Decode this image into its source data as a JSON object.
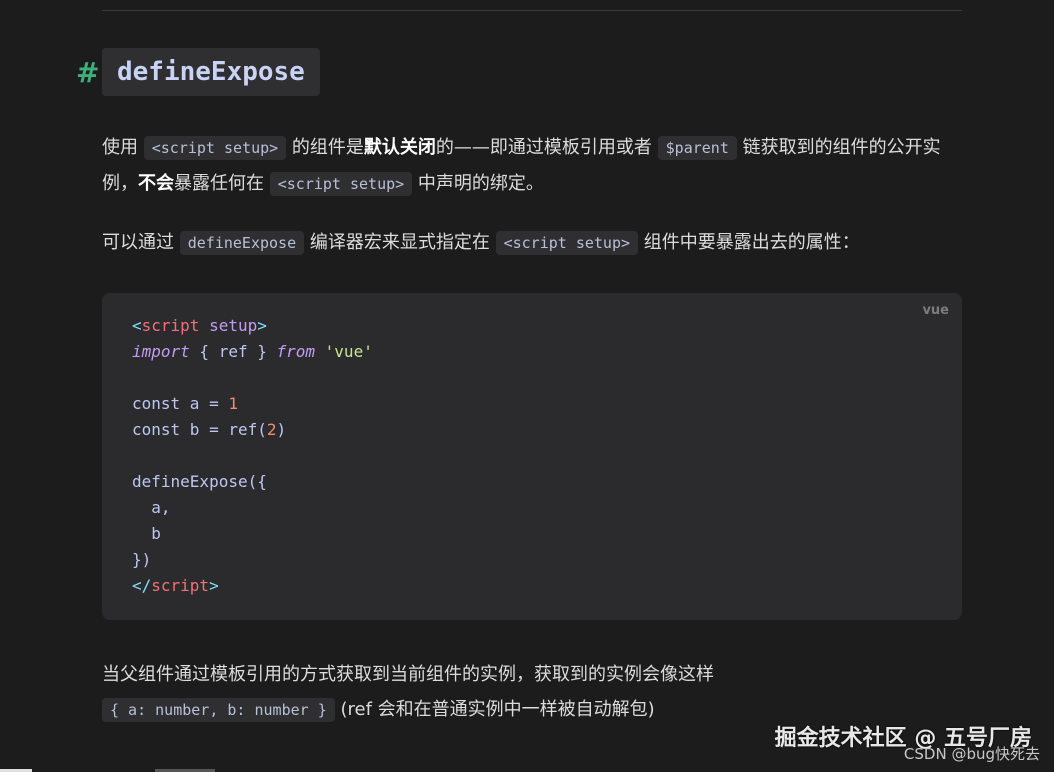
{
  "heading": {
    "hash": "#",
    "title": "defineExpose"
  },
  "p1": {
    "t1": "使用",
    "c1": "<script setup>",
    "t2": "的组件是",
    "b1": "默认关闭",
    "t3": "的——即通过模板引用或者",
    "c2": "$parent",
    "t4": "链获取到的组件的公开实例，",
    "b2": "不会",
    "t5": "暴露任何在",
    "c3": "<script setup>",
    "t6": "中声明的绑定。"
  },
  "p2": {
    "t1": "可以通过",
    "c1": "defineExpose",
    "t2": "编译器宏来显式指定在",
    "c2": "<script setup>",
    "t3": "组件中要暴露出去的属性："
  },
  "code": {
    "lang": "vue",
    "l1_open": "<",
    "l1_tag": "script",
    "l1_attr": " setup",
    "l1_close": ">",
    "l2_import": "import",
    "l2_mid": " { ref } ",
    "l2_from": "from",
    "l2_str": " 'vue'",
    "l4_text": "const a = ",
    "l4_num": "1",
    "l5_text": "const b = ref(",
    "l5_num": "2",
    "l5_end": ")",
    "l7": "defineExpose({",
    "l8": "  a,",
    "l9": "  b",
    "l10": "})",
    "l11_open": "</",
    "l11_tag": "script",
    "l11_close": ">"
  },
  "p3": {
    "t1": "当父组件通过模板引用的方式获取到当前组件的实例，获取到的实例会像这样",
    "c1": "{ a: number, b: number }",
    "t2": " (ref 会和在普通实例中一样被自动解包)"
  },
  "watermark": {
    "main": "掘金技术社区 @ 五号厂房",
    "sub": "CSDN @bug快死去"
  }
}
